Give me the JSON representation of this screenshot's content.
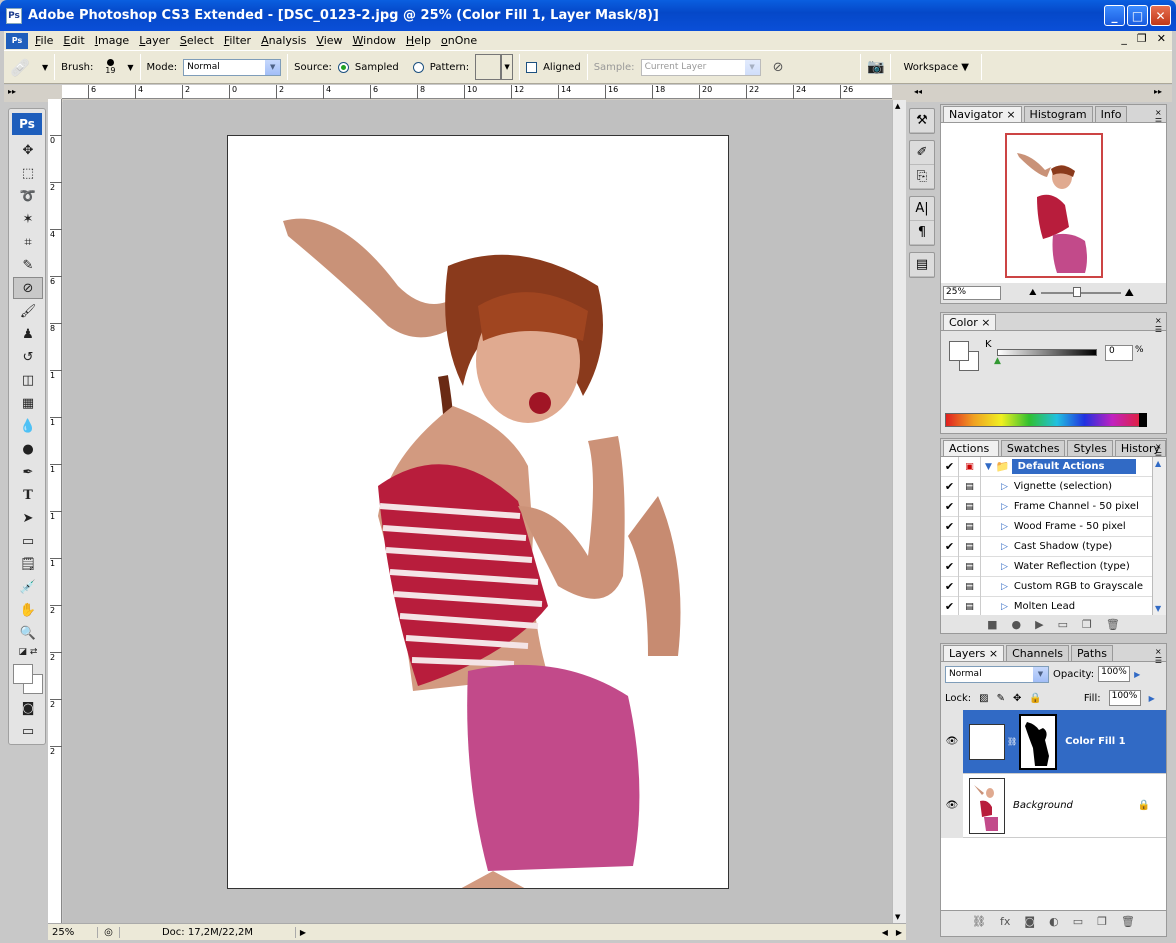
{
  "window": {
    "title": "Adobe Photoshop CS3 Extended - [DSC_0123-2.jpg @ 25% (Color Fill 1, Layer Mask/8)]",
    "app_icon": "Ps"
  },
  "menu": [
    "File",
    "Edit",
    "Image",
    "Layer",
    "Select",
    "Filter",
    "Analysis",
    "View",
    "Window",
    "Help",
    "onOne"
  ],
  "options": {
    "brush_label": "Brush:",
    "brush_size": "19",
    "mode_label": "Mode:",
    "mode_value": "Normal",
    "source_label": "Source:",
    "sampled_label": "Sampled",
    "pattern_label": "Pattern:",
    "aligned_label": "Aligned",
    "sample_label": "Sample:",
    "sample_value": "Current Layer",
    "workspace_label": "Workspace"
  },
  "ruler_h_ticks": [
    "6",
    "4",
    "2",
    "0",
    "2",
    "4",
    "6",
    "8",
    "10",
    "12",
    "14",
    "16",
    "18",
    "20",
    "22",
    "24",
    "26"
  ],
  "ruler_v_ticks": [
    "0",
    "2",
    "4",
    "6",
    "8",
    "1",
    "1",
    "1",
    "1",
    "1",
    "2",
    "2",
    "2",
    "2"
  ],
  "status": {
    "zoom": "25%",
    "doc": "Doc: 17,2M/22,2M"
  },
  "navigator": {
    "tabs": [
      "Navigator",
      "Histogram",
      "Info"
    ],
    "zoom": "25%"
  },
  "color": {
    "tab": "Color",
    "channel": "K",
    "value": "0",
    "unit": "%"
  },
  "actions": {
    "tabs": [
      "Actions",
      "Swatches",
      "Styles",
      "History"
    ],
    "items": [
      {
        "label": "Default Actions",
        "folder": true
      },
      {
        "label": "Vignette (selection)"
      },
      {
        "label": "Frame Channel - 50 pixel"
      },
      {
        "label": "Wood Frame - 50 pixel"
      },
      {
        "label": "Cast Shadow (type)"
      },
      {
        "label": "Water Reflection (type)"
      },
      {
        "label": "Custom RGB to Grayscale"
      },
      {
        "label": "Molten Lead"
      }
    ]
  },
  "layers": {
    "tabs": [
      "Layers",
      "Channels",
      "Paths"
    ],
    "blend_mode": "Normal",
    "opacity_label": "Opacity:",
    "opacity": "100%",
    "lock_label": "Lock:",
    "fill_label": "Fill:",
    "fill": "100%",
    "items": [
      {
        "name": "Color Fill 1",
        "selected": true
      },
      {
        "name": "Background",
        "selected": false
      }
    ]
  },
  "colors": {
    "accent": "#316ac5",
    "titlebar": "#0a4fd8"
  }
}
